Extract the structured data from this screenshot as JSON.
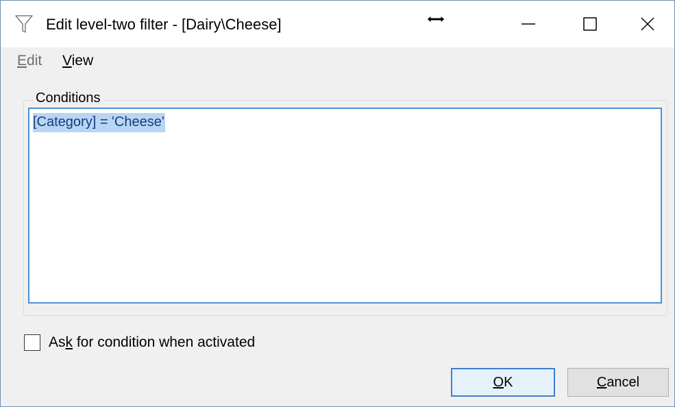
{
  "window": {
    "title": "Edit level-two filter - [Dairy\\Cheese]",
    "icon": "filter-funnel-icon"
  },
  "caption_buttons": {
    "minimize": "minimize-icon",
    "maximize": "maximize-icon",
    "close": "close-icon"
  },
  "menu": {
    "edit": {
      "pre": "",
      "accel": "E",
      "post": "dit",
      "enabled": false
    },
    "view": {
      "pre": "",
      "accel": "V",
      "post": "iew",
      "enabled": true
    }
  },
  "conditions": {
    "legend": "Conditions",
    "text": "[Category] = 'Cheese'",
    "selected": true
  },
  "ask_checkbox": {
    "pre": "As",
    "accel": "k",
    "post": " for condition when activated",
    "checked": false
  },
  "buttons": {
    "ok": {
      "pre": "",
      "accel": "O",
      "post": "K"
    },
    "cancel": {
      "pre": "",
      "accel": "C",
      "post": "ancel"
    }
  },
  "colors": {
    "selection_bg": "#b7d5f5",
    "focus_border": "#4d8fd8",
    "default_button_border": "#3c7fd4"
  }
}
